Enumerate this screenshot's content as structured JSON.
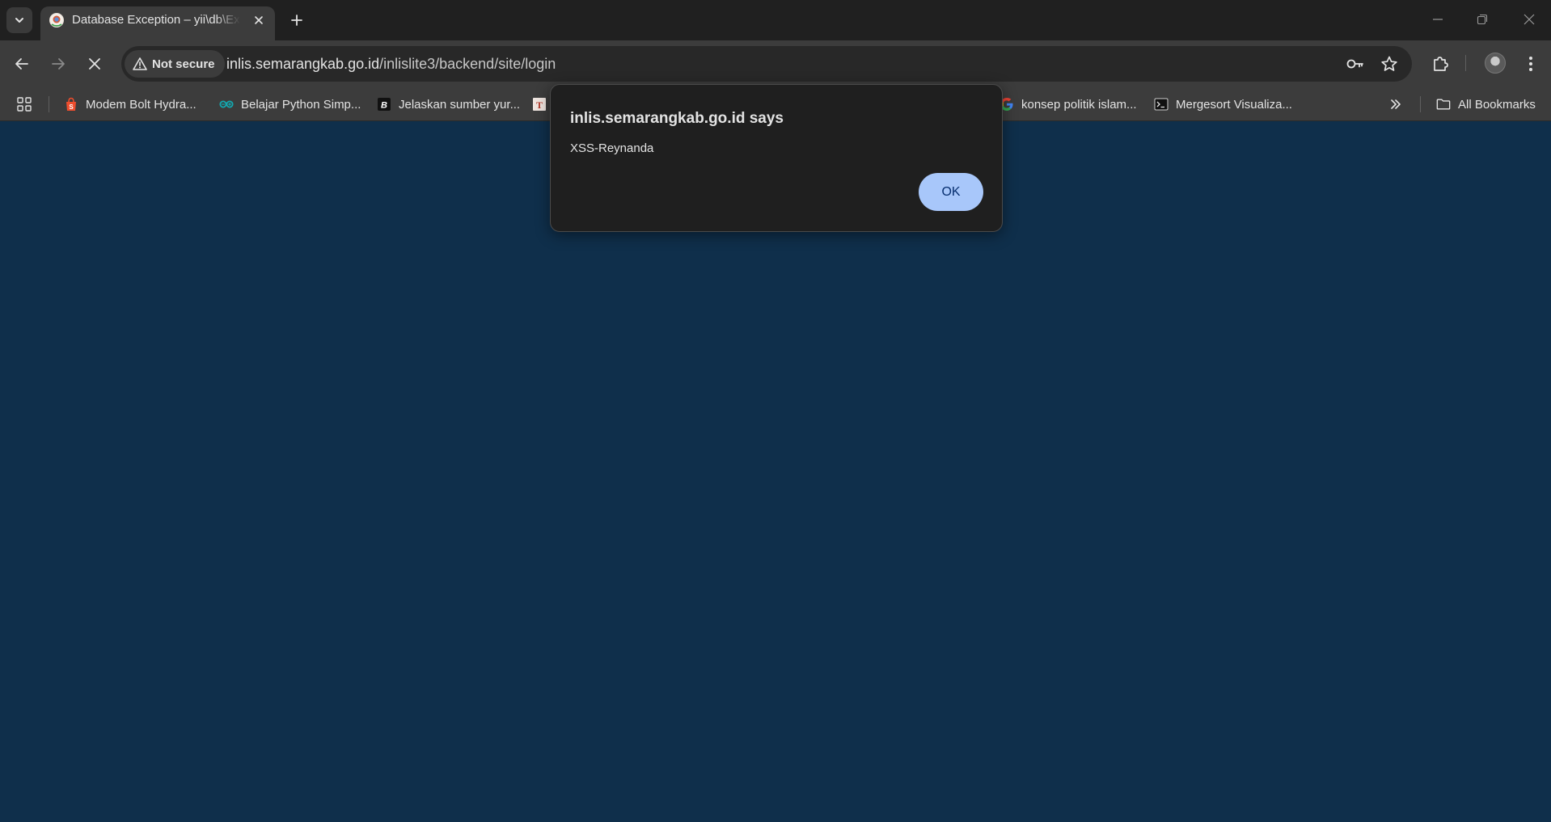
{
  "tab": {
    "title": "Database Exception – yii\\db\\Exception",
    "favicon": "yii-framework-icon"
  },
  "toolbar": {
    "security_label": "Not secure",
    "url_host": "inlis.semarangkab.go.id",
    "url_path": "/inlislite3/backend/site/login"
  },
  "bookmarks": {
    "items": [
      {
        "label": "Modem Bolt Hydra...",
        "icon": "shopee-icon"
      },
      {
        "label": "Belajar Python Simp...",
        "icon": "arduino-icon"
      },
      {
        "label": "Jelaskan sumber yur...",
        "icon": "b-icon"
      },
      {
        "label": "",
        "icon": "t-icon"
      },
      {
        "label": "konsep politik islam...",
        "icon": "google-icon"
      },
      {
        "label": "Mergesort Visualiza...",
        "icon": "terminal-icon"
      }
    ],
    "all_bookmarks_label": "All Bookmarks"
  },
  "dialog": {
    "title": "inlis.semarangkab.go.id says",
    "message": "XSS-Reynanda",
    "ok_label": "OK"
  },
  "colors": {
    "page_background": "#0f2f4b",
    "dialog_background": "#1f1f1f",
    "ok_button": "#a8c7fa"
  }
}
